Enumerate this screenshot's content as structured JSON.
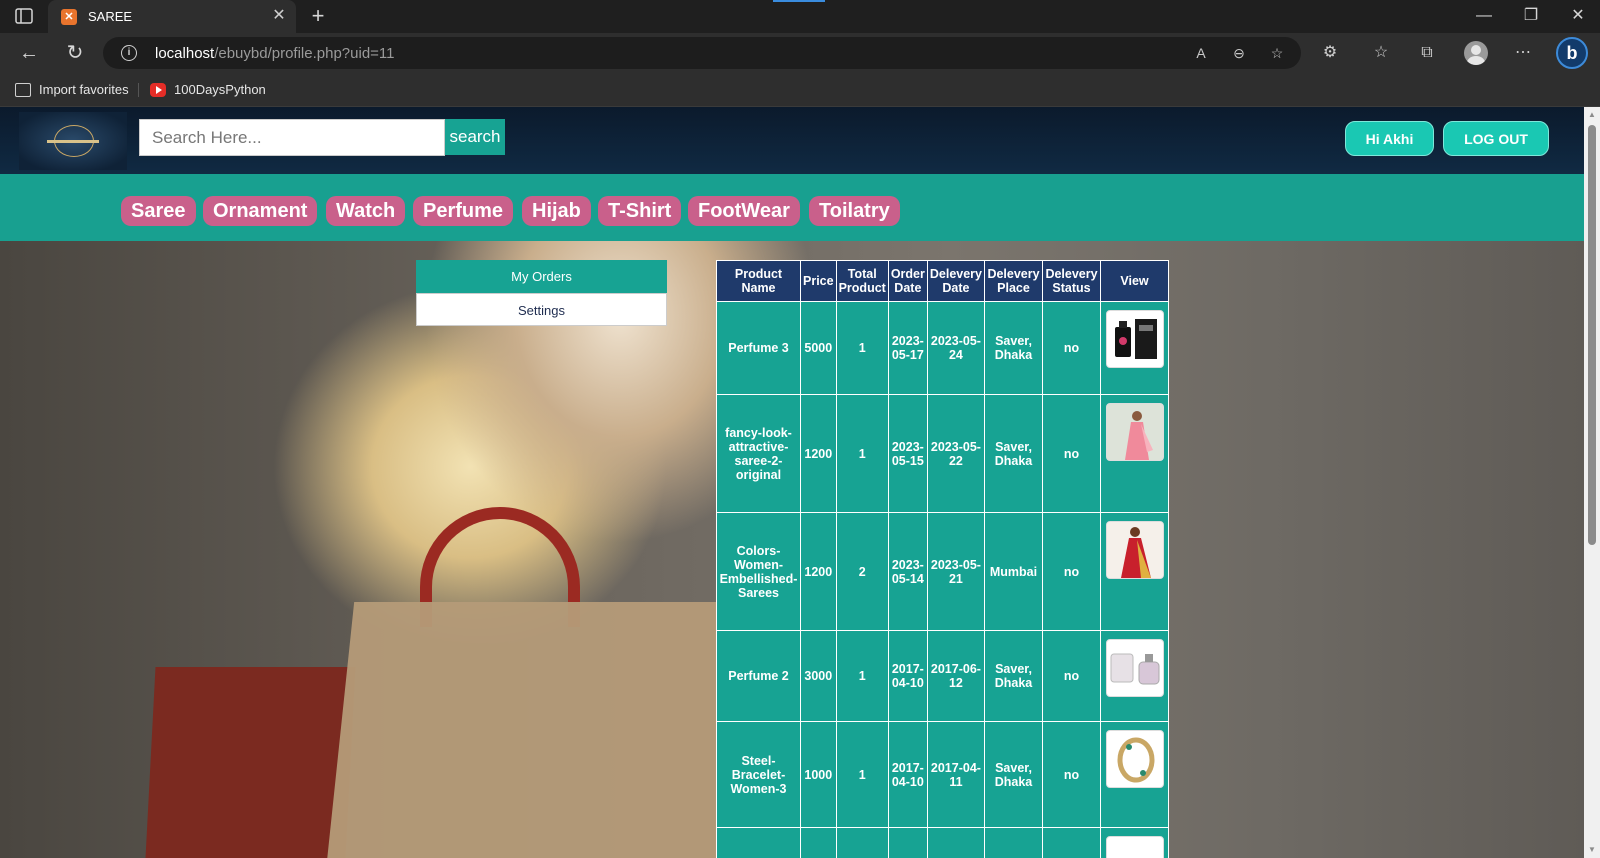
{
  "browser": {
    "tab_title": "SAREE",
    "url_host": "localhost",
    "url_path": "/ebuybd/profile.php?uid=11",
    "bookmarks": [
      {
        "label": "Import favorites",
        "icon": "import-icon"
      },
      {
        "label": "100DaysPython",
        "icon": "youtube-icon"
      }
    ]
  },
  "header": {
    "search_placeholder": "Search Here...",
    "search_button": "search",
    "greeting_button": "Hi Akhi",
    "logout_button": "LOG OUT"
  },
  "categories": [
    "Saree",
    "Ornament",
    "Watch",
    "Perfume",
    "Hijab",
    "T-Shirt",
    "FootWear",
    "Toilatry"
  ],
  "sidebar": {
    "items": [
      {
        "label": "My Orders",
        "active": true
      },
      {
        "label": "Settings",
        "active": false
      }
    ]
  },
  "orders_table": {
    "headers": [
      "Product Name",
      "Price",
      "Total Product",
      "Order Date",
      "Delevery Date",
      "Delevery Place",
      "Delevery Status",
      "View"
    ],
    "rows": [
      {
        "product": "Perfume 3",
        "price": "5000",
        "qty": "1",
        "order_date": "2023-05-17",
        "delivery_date": "2023-05-24",
        "place": "Saver, Dhaka",
        "status": "no",
        "thumb": "perfume-bottle-image"
      },
      {
        "product": "fancy-look-attractive-saree-2-original",
        "price": "1200",
        "qty": "1",
        "order_date": "2023-05-15",
        "delivery_date": "2023-05-22",
        "place": "Saver, Dhaka",
        "status": "no",
        "thumb": "pink-saree-image"
      },
      {
        "product": "Colors-Women-Embellished-Sarees",
        "price": "1200",
        "qty": "2",
        "order_date": "2023-05-14",
        "delivery_date": "2023-05-21",
        "place": "Mumbai",
        "status": "no",
        "thumb": "red-gold-saree-image"
      },
      {
        "product": "Perfume 2",
        "price": "3000",
        "qty": "1",
        "order_date": "2017-04-10",
        "delivery_date": "2017-06-12",
        "place": "Saver, Dhaka",
        "status": "no",
        "thumb": "perfume-set-image"
      },
      {
        "product": "Steel-Bracelet-Women-3",
        "price": "1000",
        "qty": "1",
        "order_date": "2017-04-10",
        "delivery_date": "2017-04-11",
        "place": "Saver, Dhaka",
        "status": "no",
        "thumb": "bracelet-image"
      }
    ]
  },
  "colors": {
    "teal": "#17a393",
    "navy_header": "#1f3a6b",
    "category_pink": "#c9608b",
    "button_cyan": "#1ac8b3"
  }
}
